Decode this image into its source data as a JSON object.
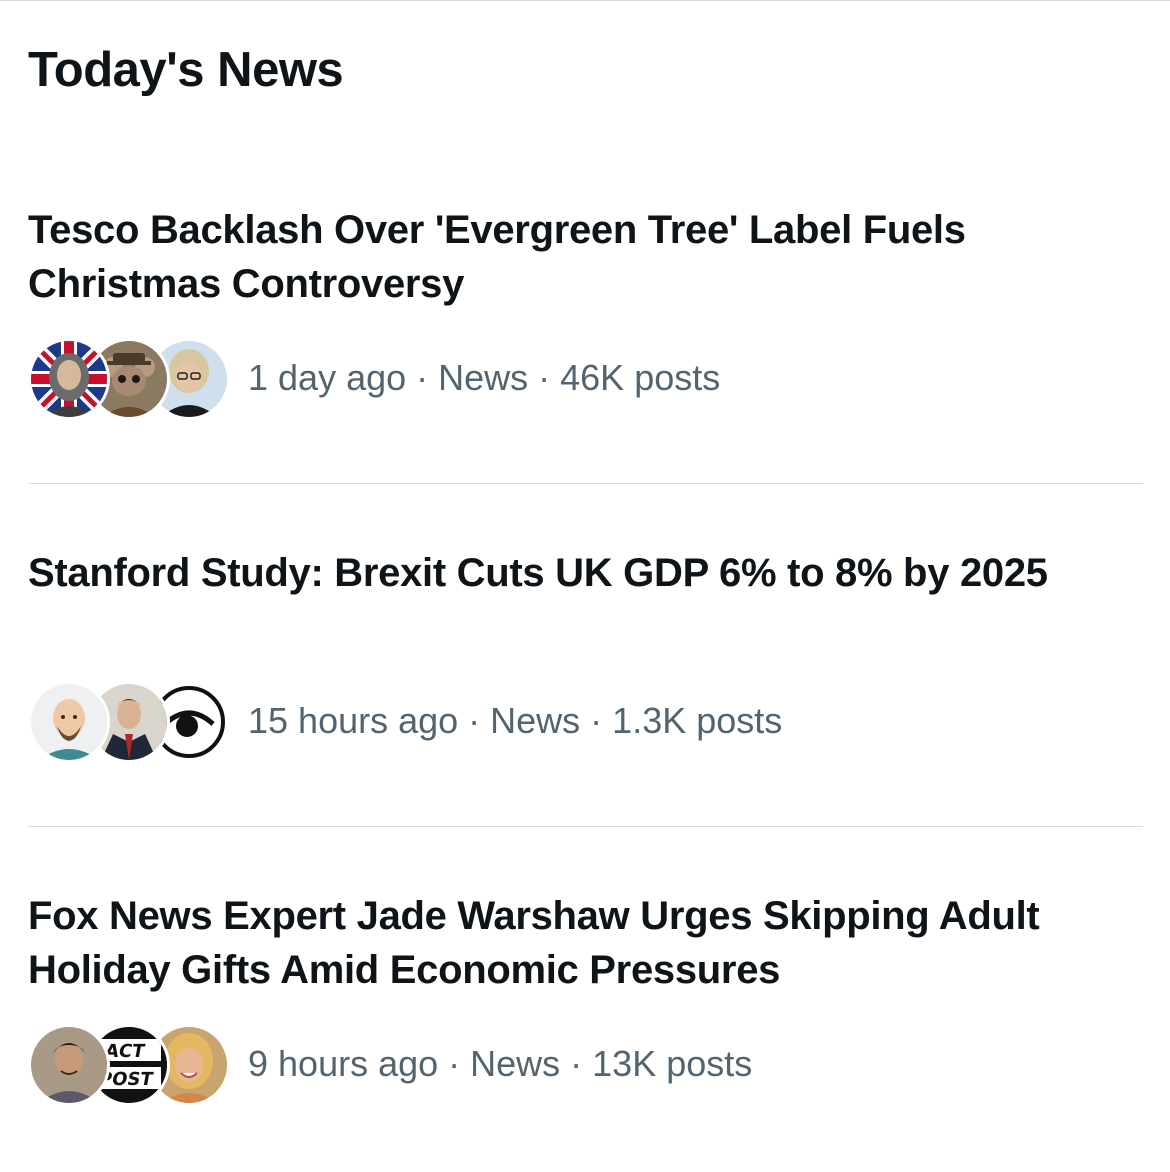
{
  "section": {
    "title": "Today's News"
  },
  "stories": [
    {
      "headline": "Tesco Backlash Over 'Evergreen Tree' Label Fuels Christmas Controversy",
      "time": "1 day ago",
      "category": "News",
      "posts": "46K posts",
      "meta": "1 day ago · News · 46K posts",
      "avatars": [
        "avatar-philosopher-flag",
        "avatar-mouse-detective",
        "avatar-woman-glasses"
      ]
    },
    {
      "headline": "Stanford Study: Brexit Cuts UK GDP 6% to 8% by 2025",
      "time": "15 hours ago",
      "category": "News",
      "posts": "1.3K posts",
      "meta": "15 hours ago · News · 1.3K posts",
      "avatars": [
        "avatar-cartoon-bald-man",
        "avatar-man-suit",
        "avatar-eye-logo"
      ]
    },
    {
      "headline": "Fox News Expert Jade Warshaw Urges Skipping Adult Holiday Gifts Amid Economic Pressures",
      "time": "9 hours ago",
      "category": "News",
      "posts": "13K posts",
      "meta": "9 hours ago · News · 13K posts",
      "avatars": [
        "avatar-young-man",
        "avatar-fact-post-logo",
        "avatar-blonde-woman"
      ],
      "logo_text": [
        "ACT",
        "POST"
      ]
    }
  ],
  "colors": {
    "text_primary": "#0f1419",
    "text_secondary": "#536471",
    "divider": "#d9dde1",
    "background": "#ffffff"
  }
}
